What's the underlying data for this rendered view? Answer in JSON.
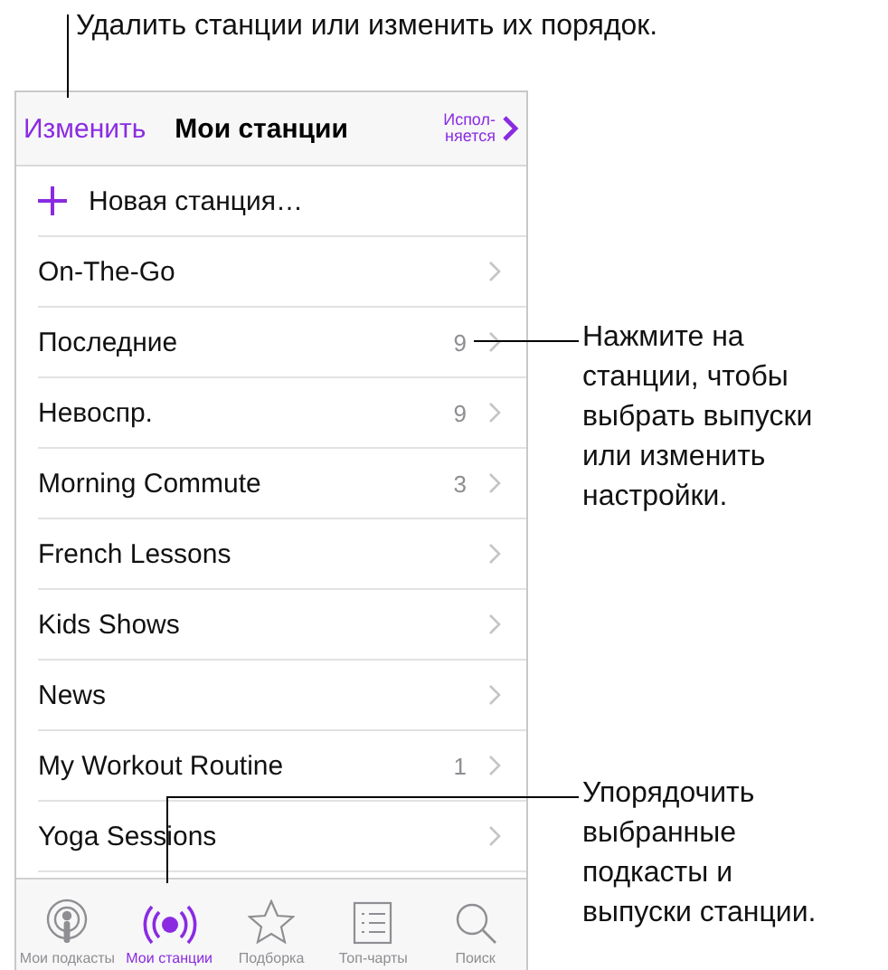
{
  "callouts": [
    {
      "lines": [
        "Удалить станции или изменить их порядок."
      ]
    },
    {
      "lines": [
        "Нажмите на",
        "станции, чтобы",
        "выбрать выпуски",
        "или изменить",
        "настройки."
      ]
    },
    {
      "lines": [
        "Упорядочить",
        "выбранные",
        "подкасты и",
        "выпуски станции."
      ]
    }
  ],
  "nav": {
    "edit": "Изменить",
    "title": "Мои станции",
    "now_playing": [
      "Испол-",
      "няется"
    ]
  },
  "add_station": "Новая станция…",
  "stations": [
    {
      "name": "On-The-Go"
    },
    {
      "name": "Последние",
      "count": "9"
    },
    {
      "name": "Невоспр.",
      "count": "9"
    },
    {
      "name": "Morning Commute",
      "count": "3"
    },
    {
      "name": "French Lessons"
    },
    {
      "name": "Kids Shows"
    },
    {
      "name": "News"
    },
    {
      "name": "My Workout Routine",
      "count": "1"
    },
    {
      "name": "Yoga Sessions"
    }
  ],
  "tabs": [
    {
      "kind": "podcasts",
      "label": "Мои подкасты",
      "selected": false
    },
    {
      "kind": "stations",
      "label": "Мои станции",
      "selected": true
    },
    {
      "kind": "featured",
      "label": "Подборка",
      "selected": false
    },
    {
      "kind": "charts",
      "label": "Топ-чарты",
      "selected": false
    },
    {
      "kind": "search",
      "label": "Поиск",
      "selected": false
    }
  ]
}
